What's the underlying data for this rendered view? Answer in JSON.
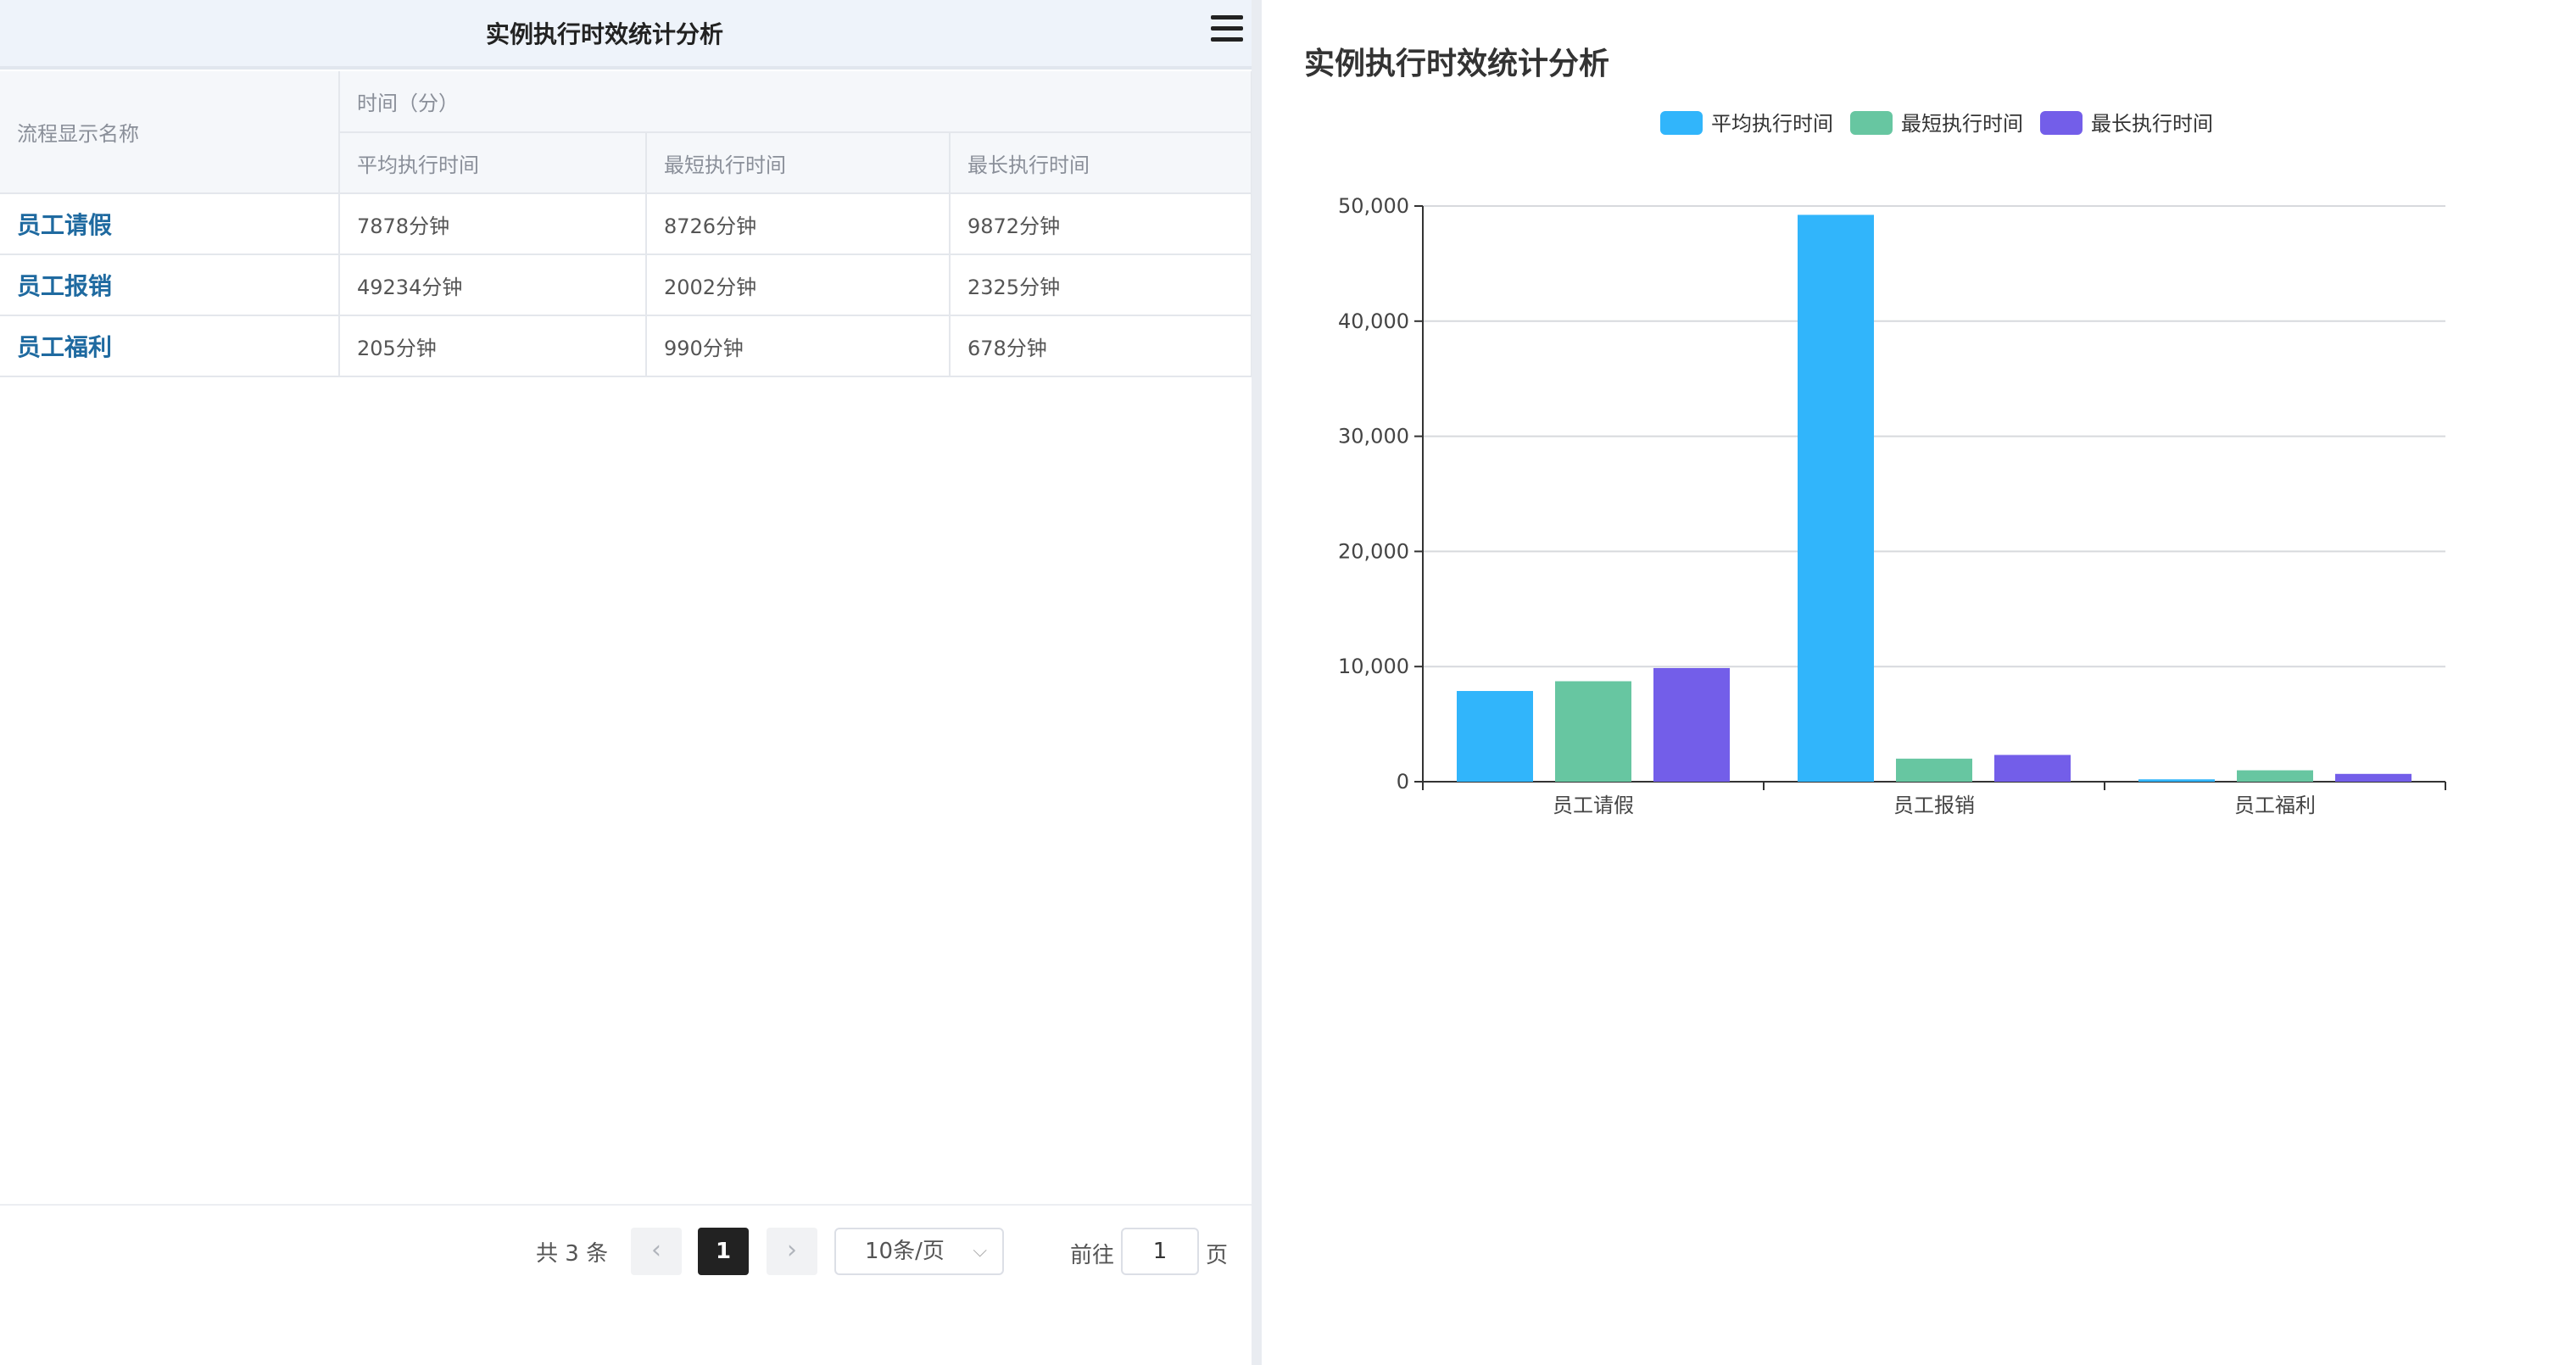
{
  "table_title": "实例执行时效统计分析",
  "columns": {
    "name": "流程显示名称",
    "group": "时间（分）",
    "avg": "平均执行时间",
    "min": "最短执行时间",
    "max": "最长执行时间"
  },
  "rows": [
    {
      "name": "员工请假",
      "avg": "7878分钟",
      "min": "8726分钟",
      "max": "9872分钟"
    },
    {
      "name": "员工报销",
      "avg": "49234分钟",
      "min": "2002分钟",
      "max": "2325分钟"
    },
    {
      "name": "员工福利",
      "avg": "205分钟",
      "min": "990分钟",
      "max": "678分钟"
    }
  ],
  "pagination": {
    "total": "共 3 条",
    "prev": "‹",
    "current": "1",
    "next": "›",
    "page_size": "10条/页",
    "goto_label": "前往",
    "goto_value": "1",
    "goto_suffix": "页"
  },
  "icons": {
    "menu": "hamburger-menu-icon",
    "prev": "chevron-left-icon",
    "next": "chevron-right-icon",
    "dropdown": "chevron-down-icon"
  },
  "chart_data": {
    "type": "bar",
    "title": "实例执行时效统计分析",
    "categories": [
      "员工请假",
      "员工报销",
      "员工福利"
    ],
    "series": [
      {
        "name": "平均执行时间",
        "color": "#31b5fb",
        "values": [
          7878,
          49234,
          205
        ]
      },
      {
        "name": "最短执行时间",
        "color": "#67c6a1",
        "values": [
          8726,
          2002,
          990
        ]
      },
      {
        "name": "最长执行时间",
        "color": "#735ee9",
        "values": [
          9872,
          2325,
          678
        ]
      }
    ],
    "ylim": [
      0,
      50000
    ],
    "yticks": [
      "0",
      "10,000",
      "20,000",
      "30,000",
      "40,000",
      "50,000"
    ],
    "grid": true,
    "legend": "top-center"
  }
}
